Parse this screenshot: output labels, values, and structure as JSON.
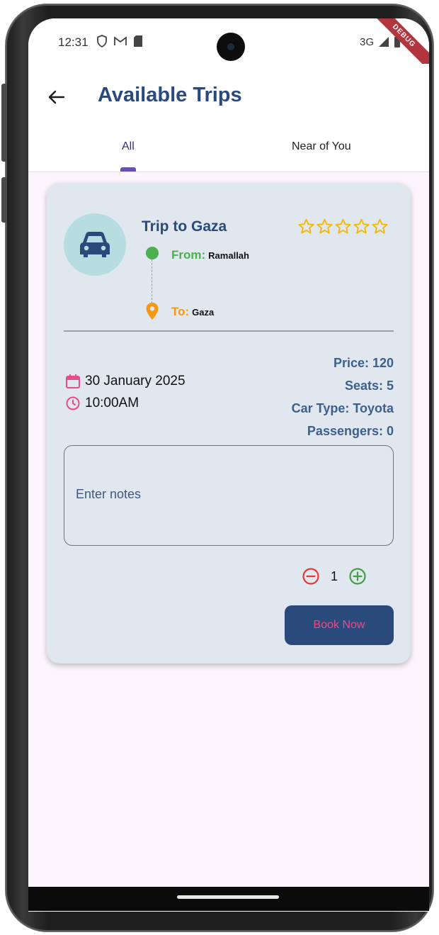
{
  "status_bar": {
    "time": "12:31",
    "network": "3G",
    "debug_label": "DEBUG"
  },
  "app_bar": {
    "title": "Available Trips"
  },
  "tabs": [
    {
      "label": "All",
      "selected": true
    },
    {
      "label": "Near of You",
      "selected": false
    }
  ],
  "trip": {
    "title": "Trip to Gaza",
    "rating": {
      "value": 0,
      "max": 5
    },
    "from_label": "From:",
    "from_city": "Ramallah",
    "to_label": "To:",
    "to_city": "Gaza",
    "date": "30 January 2025",
    "time": "10:00AM",
    "price": "Price: 120",
    "seats": "Seats: 5",
    "car_type": "Car Type: Toyota",
    "passengers": "Passengers: 0",
    "notes_placeholder": "Enter notes",
    "quantity": "1",
    "book_label": "Book Now"
  },
  "colors": {
    "primary": "#2b4a7c",
    "from_green": "#4caf50",
    "to_orange": "#f5980d",
    "accent_pink": "#e84b8a",
    "star_yellow": "#f5b800",
    "card_bg": "#e0e7ef",
    "page_bg": "#fcf6fc"
  },
  "icons": [
    "back-arrow-icon",
    "car-icon",
    "star-outline-icon",
    "location-dot-icon",
    "location-pin-icon",
    "calendar-icon",
    "clock-icon",
    "minus-circle-icon",
    "plus-circle-icon"
  ]
}
